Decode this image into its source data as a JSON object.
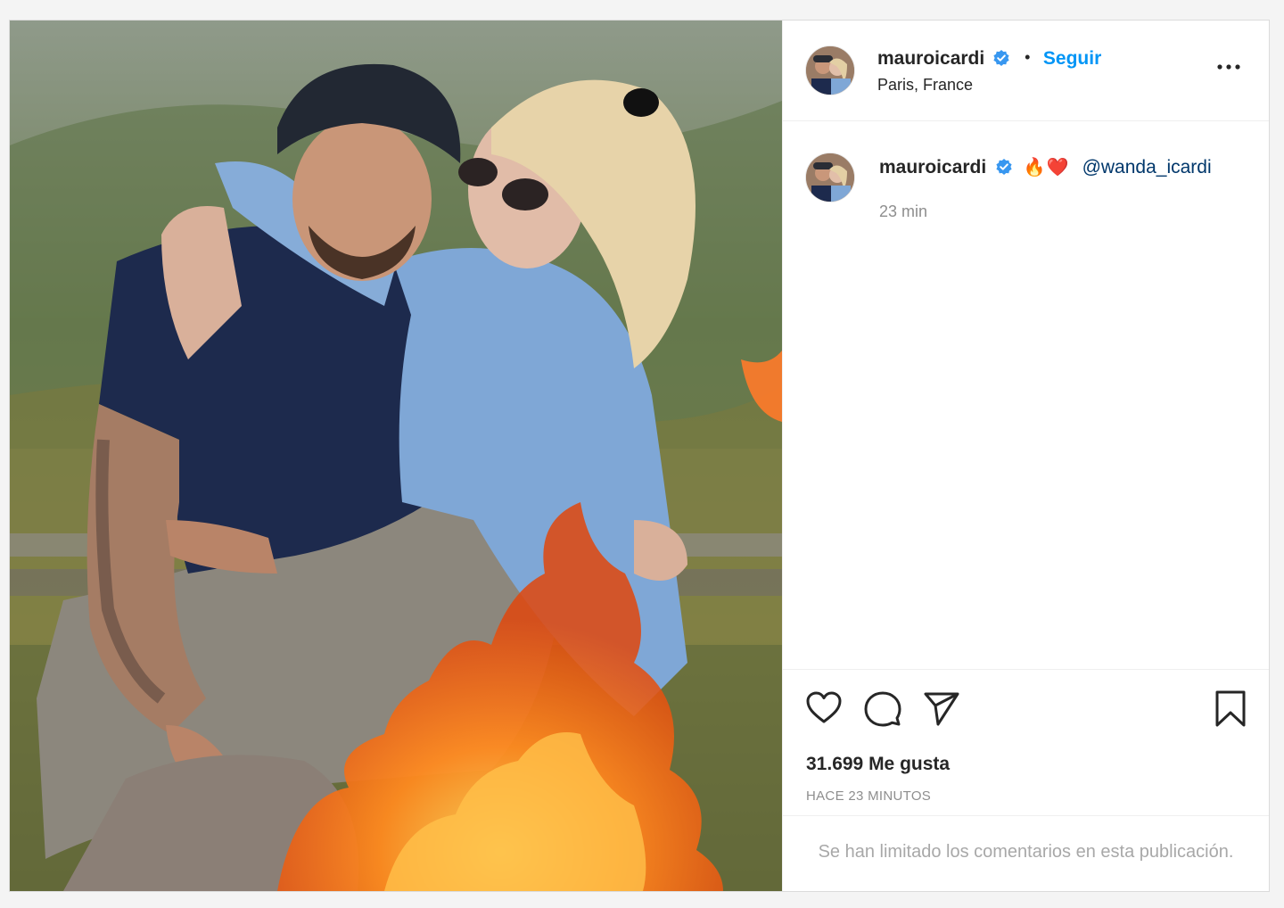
{
  "post": {
    "username": "mauroicardi",
    "follow_label": "Seguir",
    "separator": "•",
    "location": "Paris, France",
    "caption": {
      "username": "mauroicardi",
      "emojis": "🔥❤️",
      "mention": "@wanda_icardi",
      "time": "23 min"
    },
    "likes": "31.699 Me gusta",
    "posted_ago": "HACE 23 MINUTOS",
    "comments_limited": "Se han limitado los comentarios en esta publicación."
  },
  "icons": {
    "verified": "verified-badge-icon",
    "more": "more-options-icon",
    "like": "heart-icon",
    "comment": "comment-icon",
    "share": "share-icon",
    "save": "bookmark-icon"
  },
  "colors": {
    "link": "#0095f6",
    "mention": "#00376b",
    "muted": "#8e8e8e",
    "border": "#dbdbdb",
    "verified": "#3897f0"
  }
}
